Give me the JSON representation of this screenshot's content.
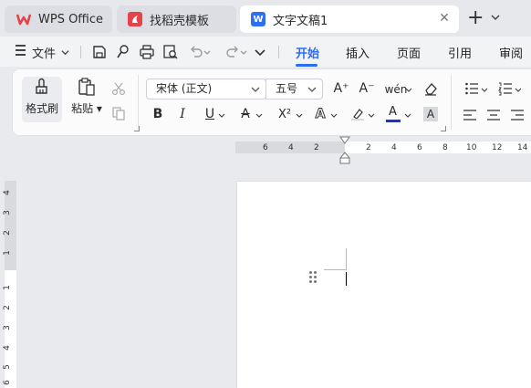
{
  "tabs": {
    "wps": {
      "label": "WPS Office"
    },
    "template": {
      "label": "找稻壳模板"
    },
    "document": {
      "label": "文字文稿1",
      "icon_letter": "W"
    }
  },
  "menubar": {
    "file_label": "文件",
    "tabs": [
      "开始",
      "插入",
      "页面",
      "引用",
      "审阅"
    ],
    "active_tab": "开始"
  },
  "ribbon": {
    "format_painter": "格式刷",
    "paste": "粘贴",
    "font_name": "宋体 (正文)",
    "font_size": "五号",
    "bold": "B",
    "italic": "I",
    "underline": "U",
    "strike": "A",
    "superscript": "X²",
    "text_effect": "A",
    "font_color": "A",
    "char_shade": "A",
    "grow_font": "A⁺",
    "shrink_font": "A⁻",
    "phonetic": "wén"
  },
  "ruler": {
    "horizontal_ticks": [
      "6",
      "4",
      "2",
      "2",
      "4",
      "6",
      "8",
      "10",
      "12",
      "14"
    ],
    "vertical_ticks": [
      "4",
      "3",
      "2",
      "1",
      "1",
      "2",
      "3",
      "4",
      "5",
      "6"
    ]
  },
  "colors": {
    "accent": "#2e6ef2",
    "wps_red": "#e5424a",
    "font_color_bar": "#1f2de0"
  }
}
